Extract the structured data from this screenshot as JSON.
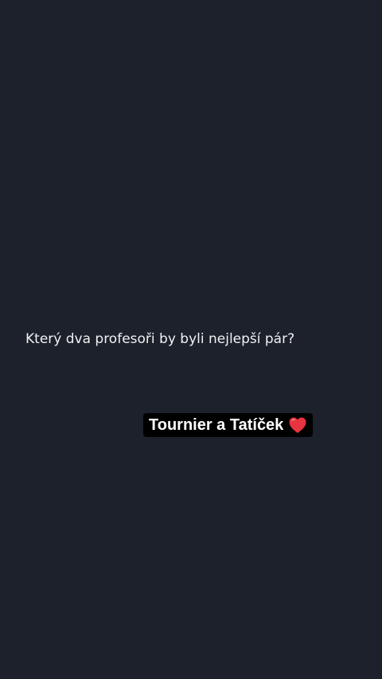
{
  "story": {
    "background_color": "#1c212c",
    "question": "Který dva profesoři by byli nejlepší pár?",
    "answer": {
      "text": "Tournier a Tatíček",
      "icon": "heart-icon",
      "icon_color": "#e8343f",
      "background_color": "#000000"
    }
  }
}
